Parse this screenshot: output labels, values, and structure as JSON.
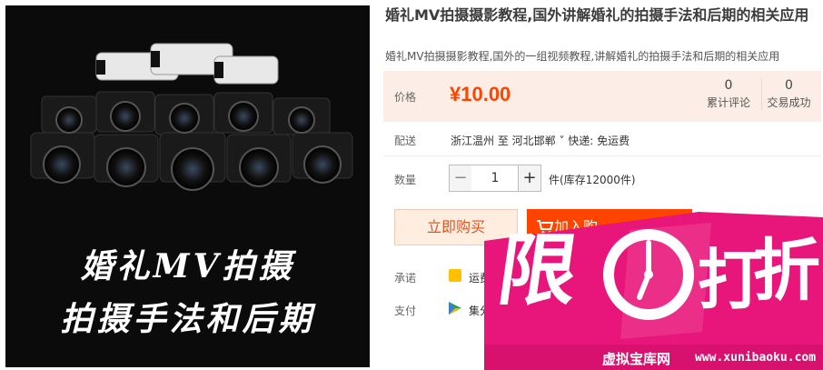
{
  "product_image": {
    "caption_line1": "婚礼MV拍摄",
    "caption_line2": "拍摄手法和后期"
  },
  "title": "婚礼MV拍摄摄影教程,国外讲解婚礼的拍摄手法和后期的相关应用",
  "subtitle": "婚礼MV拍摄摄影教程,国外的一组视频教程,讲解婚礼的拍摄手法和后期的相关应用",
  "price": {
    "label": "价格",
    "value": "¥10.00",
    "reviews_count": "0",
    "reviews_label": "累计评论",
    "sales_count": "0",
    "sales_label": "交易成功"
  },
  "shipping": {
    "label": "配送",
    "text": "浙江温州  至  河北邯郸 ˅  快递: 免运费"
  },
  "quantity": {
    "label": "数量",
    "minus": "−",
    "value": "1",
    "plus": "+",
    "unit": "件(库存12000件)"
  },
  "actions": {
    "buy_now": "立即购买",
    "add_to_cart": "加入购"
  },
  "promise": {
    "label": "承诺",
    "text": "运费"
  },
  "payment": {
    "label": "支付",
    "text": "集分"
  },
  "promo_banner": {
    "char1": "限",
    "char2": "打",
    "char3": "折",
    "site_name": "虚拟宝库网",
    "site_url": "www.xunibaoku.com"
  },
  "colors": {
    "price": "#ff4400",
    "cart_button": "#ff4400",
    "promo_pink": "#e8157b"
  }
}
